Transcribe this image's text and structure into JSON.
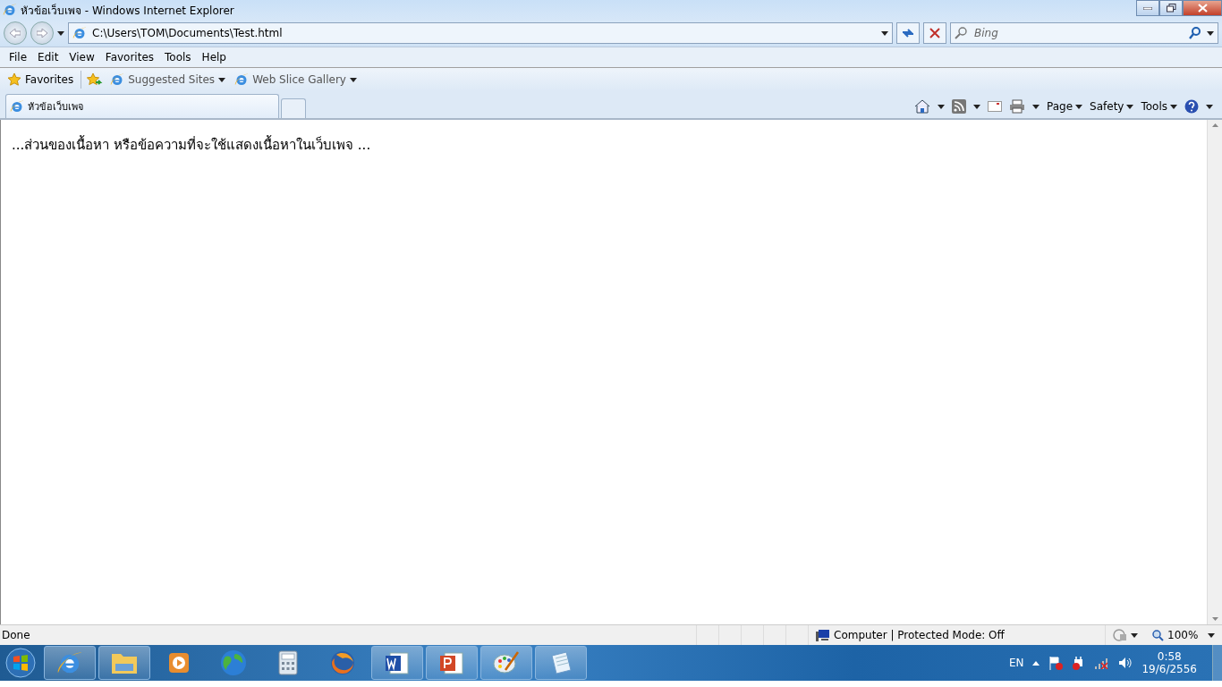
{
  "window": {
    "title": "หัวข้อเว็บเพจ - Windows Internet Explorer"
  },
  "address_bar": {
    "value": "C:\\Users\\TOM\\Documents\\Test.html"
  },
  "search": {
    "placeholder": "Bing"
  },
  "menu": [
    "File",
    "Edit",
    "View",
    "Favorites",
    "Tools",
    "Help"
  ],
  "favorites_bar": {
    "favorites": "Favorites",
    "links": [
      "Suggested Sites",
      "Web Slice Gallery"
    ]
  },
  "tabs": [
    {
      "label": "หัวข้อเว็บเพจ",
      "selected": true
    }
  ],
  "command_bar": [
    "Page",
    "Safety",
    "Tools"
  ],
  "content": {
    "text": "...ส่วนของเนื้อหา หรือข้อความที่จะใช้แสดงเนื้อหาในเว็บเพจ ..."
  },
  "status_bar": {
    "status": "Done",
    "zone": "Computer | Protected Mode: Off",
    "zoom": "100%"
  },
  "taskbar": {
    "items": [
      {
        "kind": "ie",
        "running": true
      },
      {
        "kind": "folder",
        "running": true
      },
      {
        "kind": "media",
        "running": false
      },
      {
        "kind": "globe",
        "running": false
      },
      {
        "kind": "calculator",
        "running": false
      },
      {
        "kind": "firefox",
        "running": false
      },
      {
        "kind": "word",
        "running": true
      },
      {
        "kind": "powerpoint",
        "running": true
      },
      {
        "kind": "paint",
        "running": true
      },
      {
        "kind": "notepad",
        "running": true
      }
    ],
    "language": "EN",
    "time": "0:58",
    "date": "19/6/2556"
  }
}
